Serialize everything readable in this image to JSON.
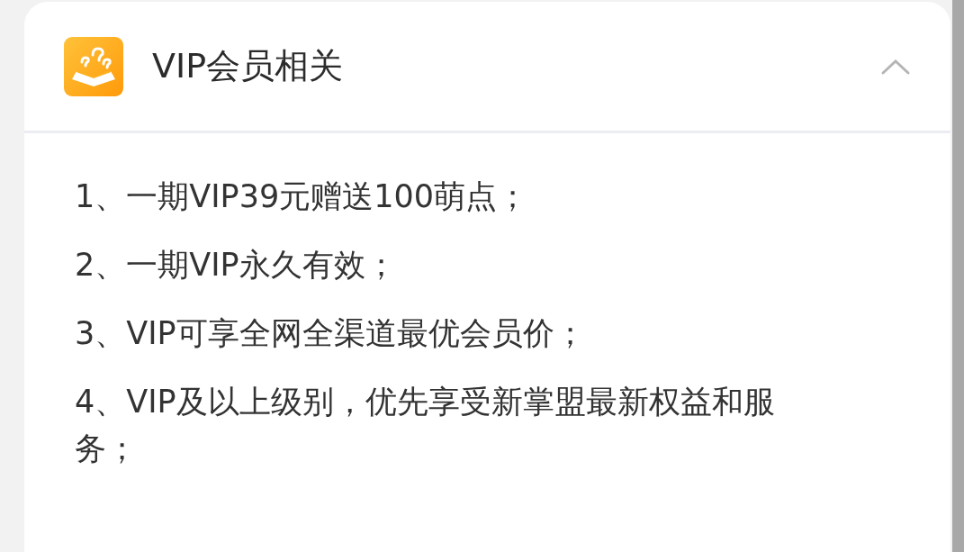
{
  "section": {
    "title": "VIP会员相关",
    "expanded": true,
    "items": [
      "1、一期VIP39元赠送100萌点；",
      "2、一期VIP永久有效；",
      "3、VIP可享全网全渠道最优会员价；",
      "4、VIP及以上级别，优先享受新掌盟最新权益和服务；"
    ]
  }
}
